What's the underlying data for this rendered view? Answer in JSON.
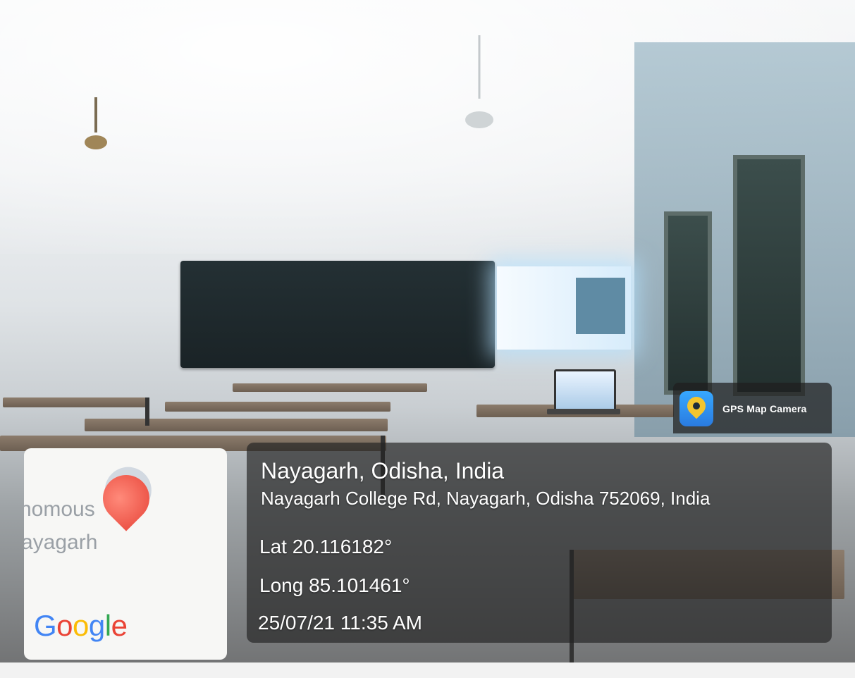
{
  "overlay": {
    "brand_label": "GPS Map Camera",
    "city": "Nayagarh, Odisha, India",
    "address": "Nayagarh College Rd, Nayagarh, Odisha 752069, India",
    "latitude": "Lat 20.116182°",
    "longitude": "Long 85.101461°",
    "datetime": "25/07/21 11:35 AM"
  },
  "map_thumbnail": {
    "label_line1": "nomous",
    "label_line2": "ayagarh",
    "logo_letters": [
      "G",
      "o",
      "o",
      "g",
      "l",
      "e"
    ]
  },
  "colors": {
    "panel_bg": "#232323",
    "pin": "#e8473b",
    "google_blue": "#4285f4",
    "google_red": "#ea4335",
    "google_yellow": "#fbbc05",
    "google_green": "#34a853"
  }
}
